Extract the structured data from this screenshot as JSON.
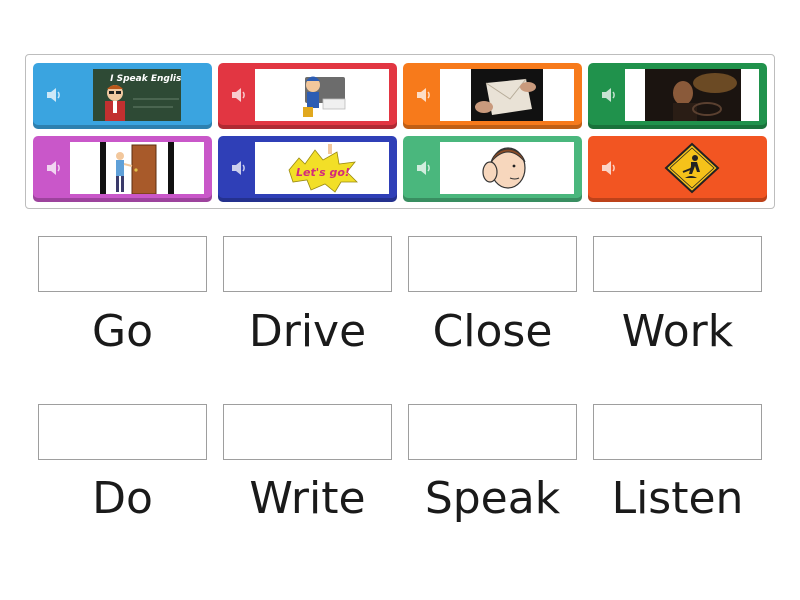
{
  "tiles": [
    {
      "color": "#3aa4e0",
      "image": "i-speak-english-boy-picture",
      "caption": "I Speak English!"
    },
    {
      "color": "#e23642",
      "image": "boy-writing-picture"
    },
    {
      "color": "#f77a1b",
      "image": "hands-closing-envelope-picture"
    },
    {
      "color": "#20924c",
      "image": "man-driving-at-night-picture"
    },
    {
      "color": "#c957c9",
      "image": "person-closing-door-picture"
    },
    {
      "color": "#2f3fb7",
      "image": "lets-go-badge-picture",
      "caption": "Let's go!"
    },
    {
      "color": "#4ab77d",
      "image": "person-listening-picture"
    },
    {
      "color": "#f25522",
      "image": "men-at-work-sign-picture"
    }
  ],
  "targets": [
    {
      "label": "Go"
    },
    {
      "label": "Drive"
    },
    {
      "label": "Close"
    },
    {
      "label": "Work"
    },
    {
      "label": "Do"
    },
    {
      "label": "Write"
    },
    {
      "label": "Speak"
    },
    {
      "label": "Listen"
    }
  ]
}
